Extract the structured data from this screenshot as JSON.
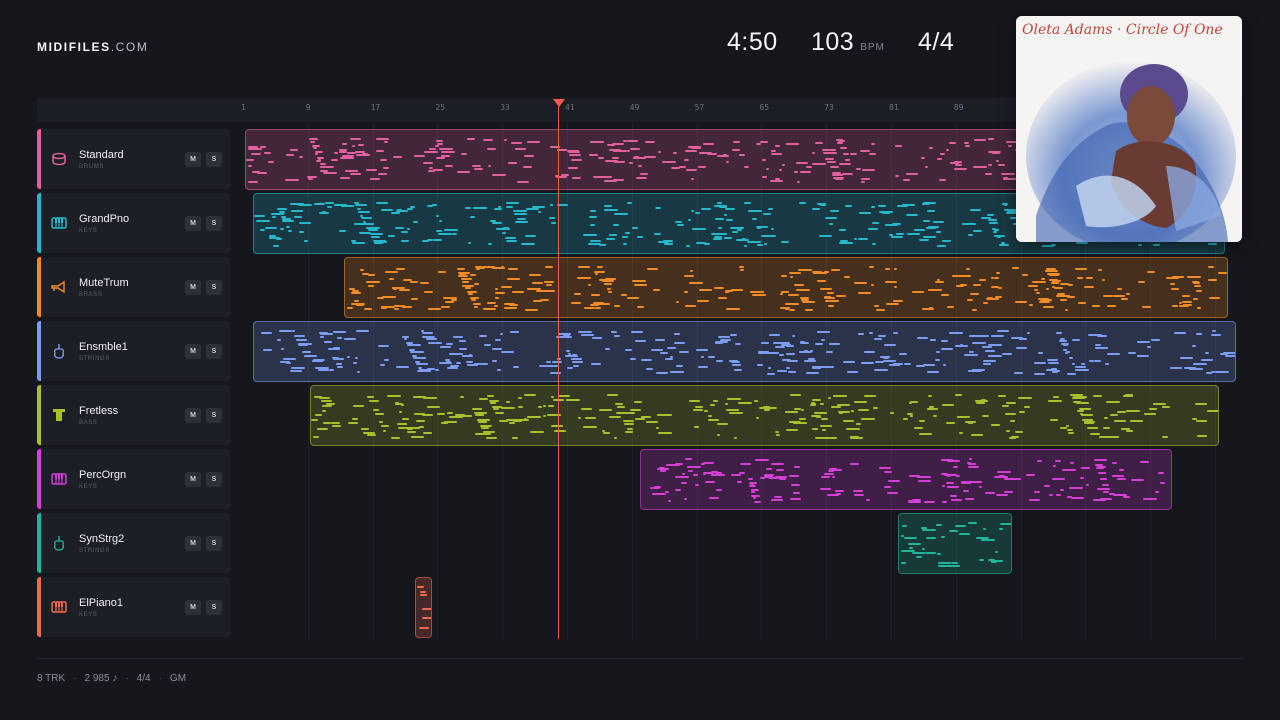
{
  "brand": {
    "name": "MIDIFILES",
    "suffix": ".COM"
  },
  "header": {
    "duration": "4:50",
    "tempo": "103",
    "tempo_unit": "BPM",
    "time_signature": "4/4"
  },
  "ruler": {
    "bars": [
      "1",
      "9",
      "17",
      "25",
      "33",
      "41",
      "49",
      "57",
      "65",
      "73",
      "81",
      "89"
    ]
  },
  "playhead": {
    "bar": 40.5
  },
  "tracks": [
    {
      "name": "Standard",
      "category": "DRUMS",
      "color": "#e25fa0",
      "icon": "drum-icon",
      "mute": "M",
      "solo": "S"
    },
    {
      "name": "GrandPno",
      "category": "KEYS",
      "color": "#25b7cc",
      "icon": "piano-icon",
      "mute": "M",
      "solo": "S"
    },
    {
      "name": "MuteTrum",
      "category": "BRASS",
      "color": "#f08b26",
      "icon": "trumpet-icon",
      "mute": "M",
      "solo": "S"
    },
    {
      "name": "Ensmble1",
      "category": "STRINGS",
      "color": "#7b9cf1",
      "icon": "violin-icon",
      "mute": "M",
      "solo": "S"
    },
    {
      "name": "Fretless",
      "category": "BASS",
      "color": "#a9c02c",
      "icon": "bass-icon",
      "mute": "M",
      "solo": "S"
    },
    {
      "name": "PercOrgn",
      "category": "KEYS",
      "color": "#d53fd6",
      "icon": "piano-icon",
      "mute": "M",
      "solo": "S"
    },
    {
      "name": "SynStrg2",
      "category": "STRINGS",
      "color": "#1fb59b",
      "icon": "violin-icon",
      "mute": "M",
      "solo": "S"
    },
    {
      "name": "ElPiano1",
      "category": "KEYS",
      "color": "#f2694e",
      "icon": "piano-icon",
      "mute": "M",
      "solo": "S"
    }
  ],
  "album": {
    "title": "Oleta Adams · Circle Of One"
  },
  "footer": {
    "tracks": "8 TRK",
    "notes": "2 985 ♪",
    "meter": "4/4",
    "standard": "GM"
  }
}
